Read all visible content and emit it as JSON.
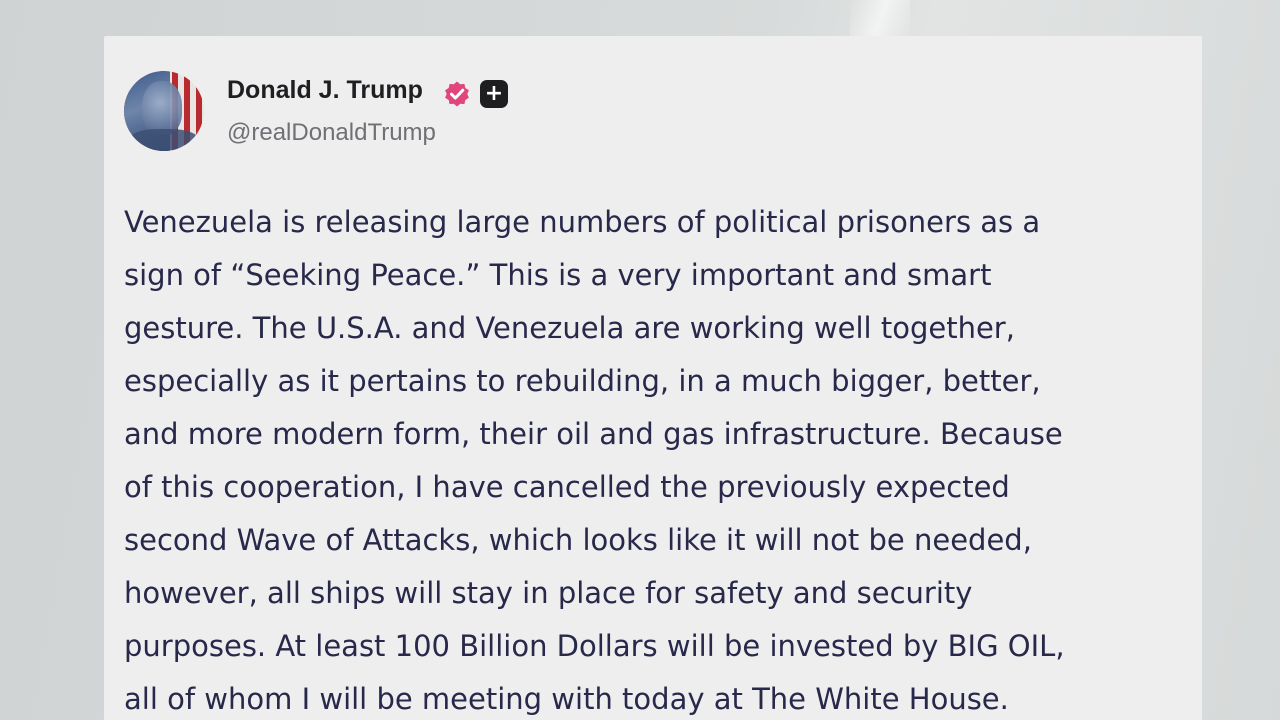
{
  "post": {
    "author": {
      "display_name": "Donald J. Trump",
      "handle": "@realDonaldTrump"
    },
    "icons": {
      "avatar": "avatar-flag-portrait",
      "verified": "verified-badge-icon",
      "plus": "plus-badge-icon"
    },
    "colors": {
      "verified": "#e0457b",
      "text": "#28284a",
      "card_background": "#eeeeef"
    },
    "lines": [
      "Venezuela is releasing large numbers of political prisoners as a",
      "sign of “Seeking Peace.” This is a very important and smart",
      "gesture. The U.S.A. and Venezuela are working well together,",
      "especially as it pertains to rebuilding, in a much bigger, better,",
      "and more modern form, their oil and gas infrastructure. Because",
      "of this cooperation, I have cancelled the previously expected",
      "second Wave of Attacks, which looks like it will not be needed,",
      "however, all ships will stay in place for safety and security",
      "purposes. At least 100 Billion Dollars will be invested by BIG OIL,",
      "all of whom I will be meeting with today at The White House."
    ]
  }
}
